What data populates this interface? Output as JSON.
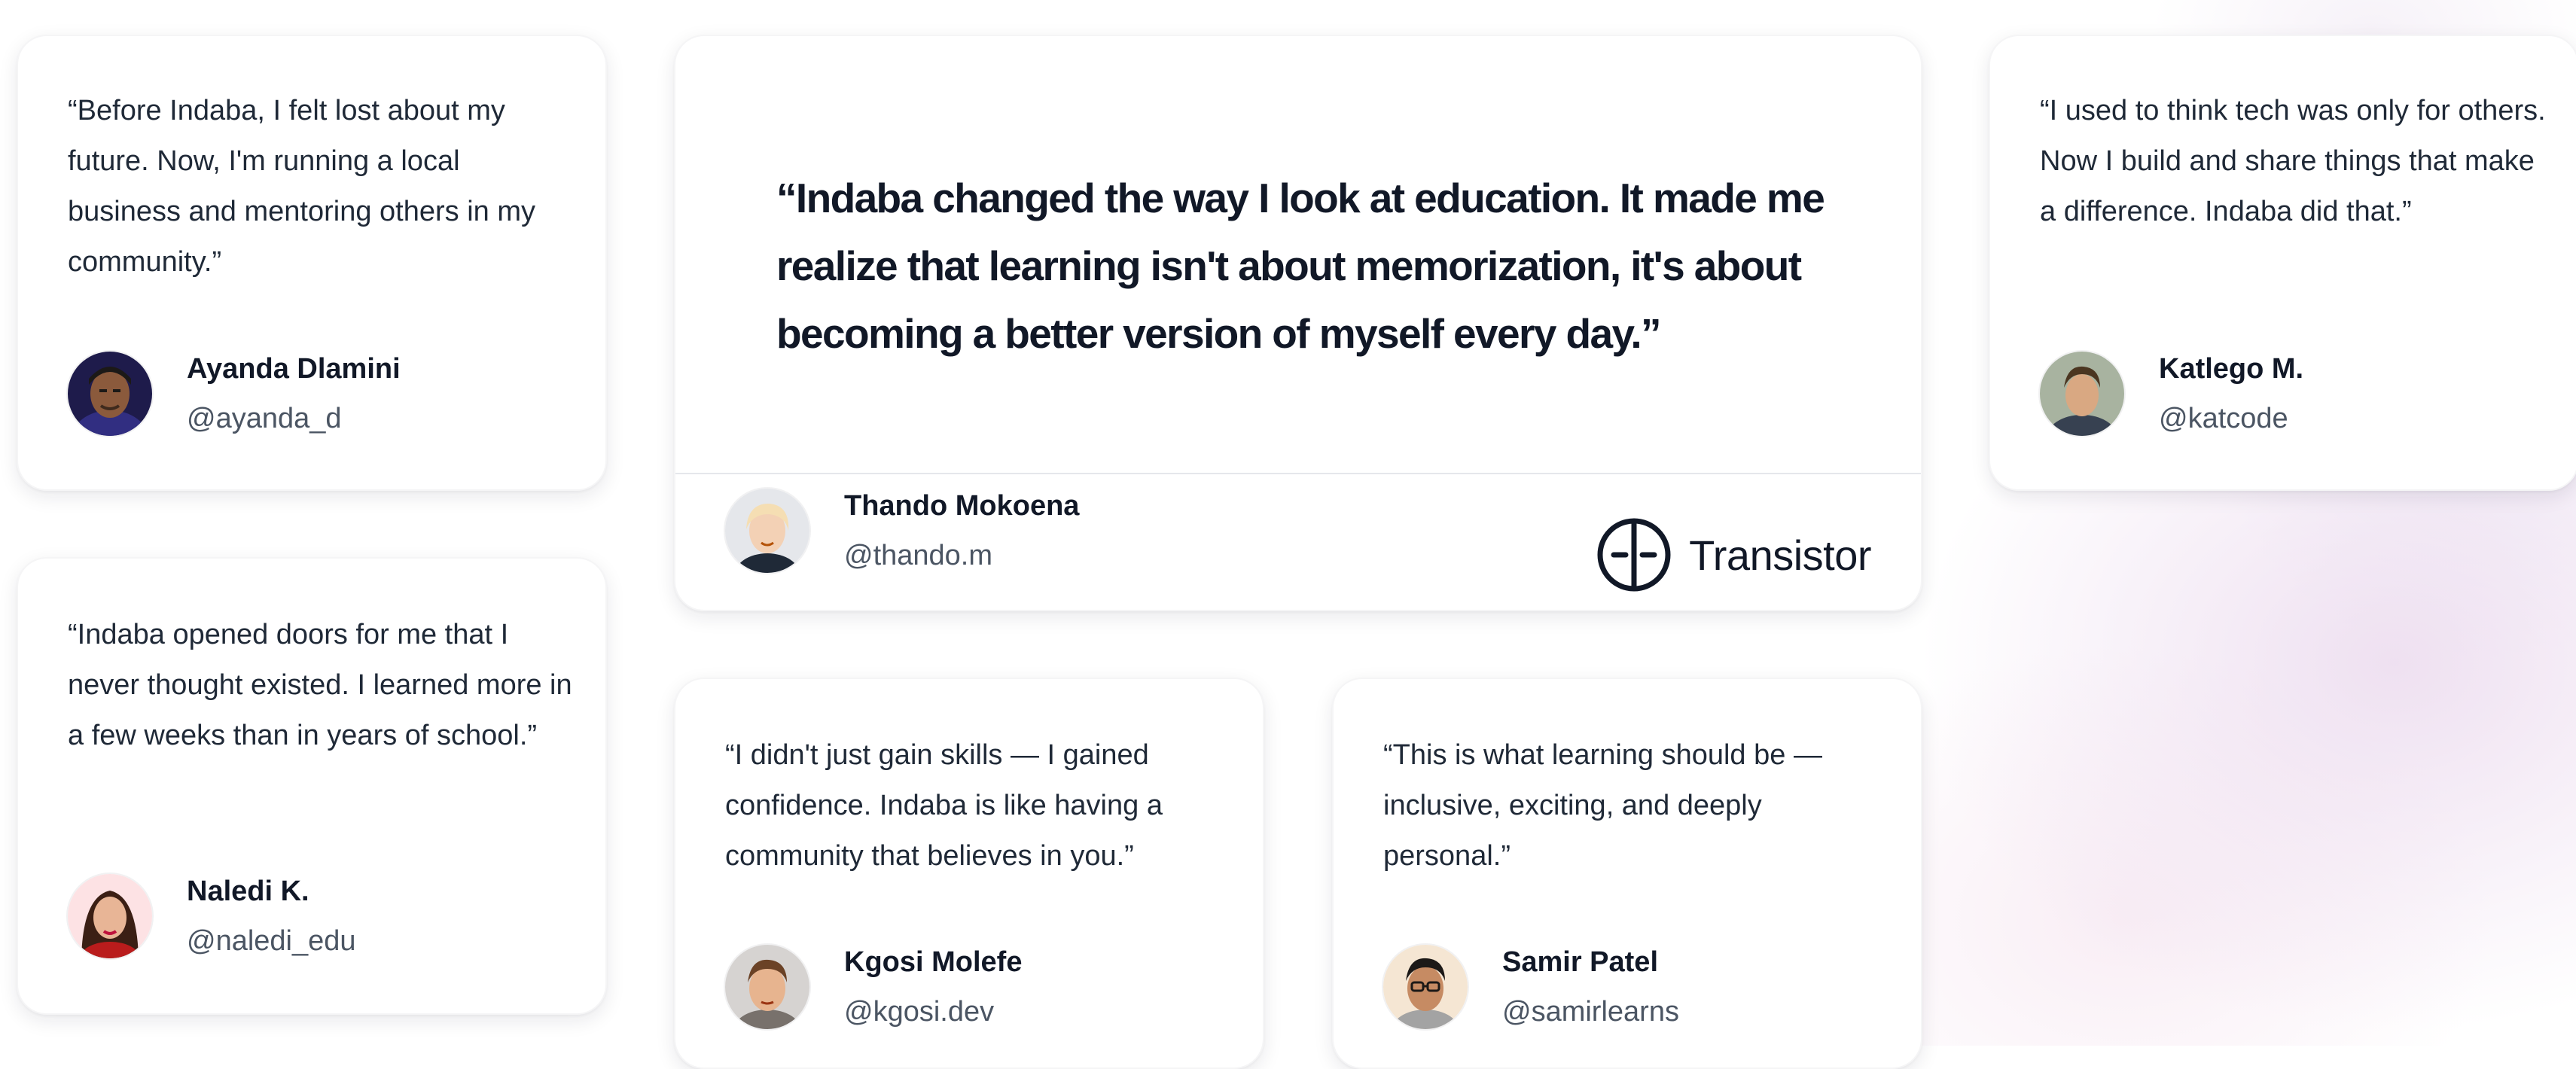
{
  "testimonials": {
    "ayanda": {
      "quote": "“Before Indaba, I felt lost about my future. Now, I'm running a local business and mentoring others in my community.”",
      "name": "Ayanda Dlamini",
      "handle": "@ayanda_d"
    },
    "naledi": {
      "quote": "“Indaba opened doors for me that I never thought existed. I learned more in a few weeks than in years of school.”",
      "name": "Naledi K.",
      "handle": "@naledi_edu"
    },
    "featured": {
      "quote": "“Indaba changed the way I look at education. It made me realize that learning isn't about memorization, it's about becoming a better version of myself every day.”",
      "name": "Thando Mokoena",
      "handle": "@thando.m",
      "logo_text": "Transistor"
    },
    "kgosi": {
      "quote": "“I didn't just gain skills — I gained confidence. Indaba is like having a community that believes in you.”",
      "name": "Kgosi Molefe",
      "handle": "@kgosi.dev"
    },
    "samir": {
      "quote": "“This is what learning should be — inclusive, exciting, and deeply personal.”",
      "name": "Samir Patel",
      "handle": "@samirlearns"
    },
    "katlego": {
      "quote": "“I used to think tech was only for others. Now I build and share things that make a difference. Indaba did that.”",
      "name": "Katlego M.",
      "handle": "@katcode"
    }
  },
  "icons": {
    "logo": "transistor-logo-icon",
    "avatar": "user-avatar"
  },
  "colors": {
    "text_primary": "#111827",
    "text_secondary": "#4b5563",
    "card_background": "#ffffff",
    "background_glow": "#e9d6ec"
  }
}
